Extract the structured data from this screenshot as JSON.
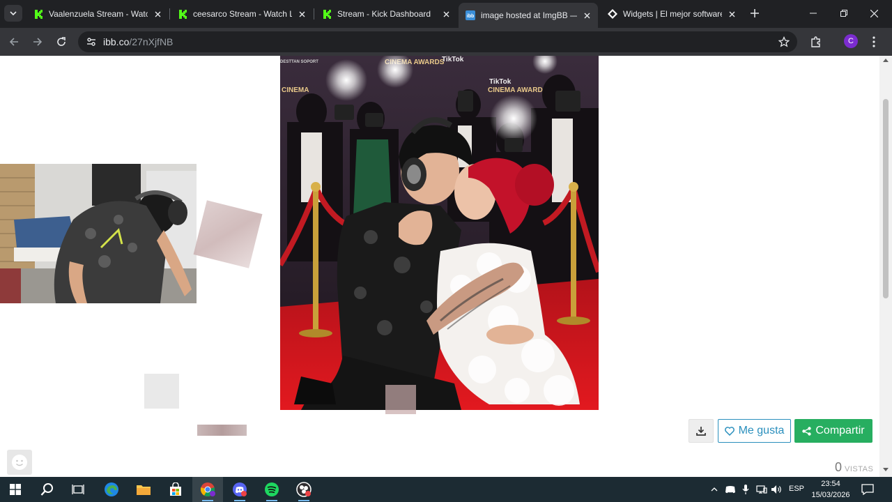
{
  "browser": {
    "tabs": [
      {
        "title": "Vaalenzuela Stream - Watch",
        "favicon": "kick-icon",
        "active": false
      },
      {
        "title": "ceesarco Stream - Watch Liv",
        "favicon": "kick-icon",
        "active": false
      },
      {
        "title": "Stream - Kick Dashboard",
        "favicon": "kick-icon",
        "active": false
      },
      {
        "title": "image hosted at ImgBB — I",
        "favicon": "imgbb-icon",
        "active": true
      },
      {
        "title": "Widgets | El mejor software",
        "favicon": "widgets-icon",
        "active": false
      }
    ],
    "url_domain": "ibb.co",
    "url_path": "/27nXjfNB",
    "profile_initial": "C"
  },
  "page": {
    "like_label": "Me gusta",
    "share_label": "Compartir",
    "views_count": "0",
    "views_label": "VISTAS",
    "image_signage": [
      "CINEMA AWARDS",
      "TikTok",
      "TikTok",
      "CINEMA AWARDS",
      "DESTTAN SOPORT"
    ]
  },
  "taskbar": {
    "apps": [
      "windows-start",
      "search",
      "task-view",
      "edge",
      "file-explorer",
      "microsoft-store",
      "chrome",
      "discord",
      "spotify",
      "obs"
    ],
    "lang": "ESP",
    "time": "23:54",
    "date": "15/03/2026"
  },
  "colors": {
    "kick_green": "#53fc18",
    "share_green": "#27ae60",
    "like_blue": "#2a8fbd",
    "profile_purple": "#7b2ccf",
    "carpet_red": "#d0141b"
  }
}
